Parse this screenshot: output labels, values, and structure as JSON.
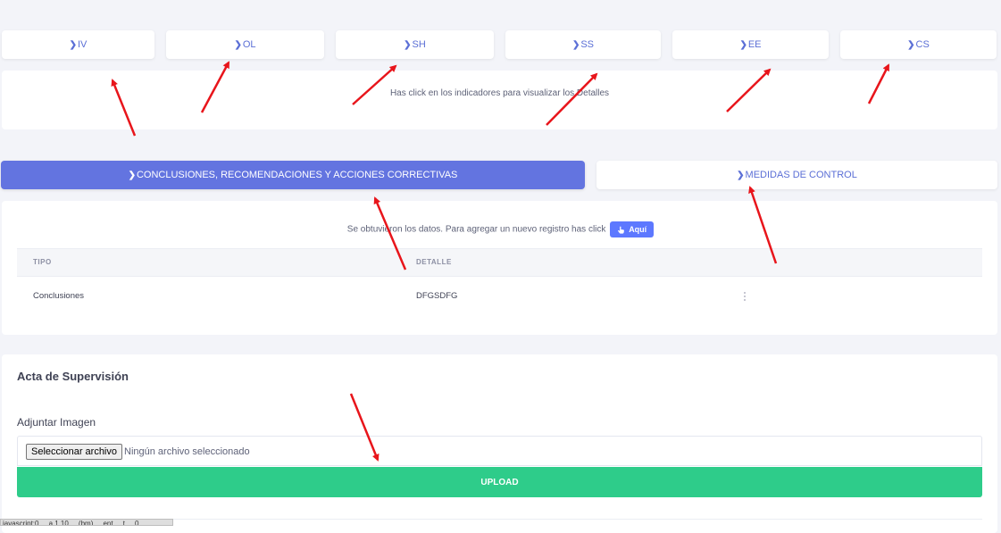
{
  "indicators": [
    {
      "label": "IV"
    },
    {
      "label": "OL"
    },
    {
      "label": "SH"
    },
    {
      "label": "SS"
    },
    {
      "label": "EE"
    },
    {
      "label": "CS"
    }
  ],
  "indicator_hint": "Has click en los indicadores para visualizar los Detalles",
  "tabs": {
    "conclusions": "CONCLUSIONES, RECOMENDACIONES Y ACCIONES CORRECTIVAS",
    "control_measures": "MEDIDAS DE CONTROL"
  },
  "records": {
    "message": "Se obtuvieron los datos. Para agregar un nuevo registro has click",
    "add_button": "Aquí",
    "columns": [
      "TIPO",
      "DETALLE"
    ],
    "rows": [
      {
        "tipo": "Conclusiones",
        "detalle": "DFGSDFG"
      }
    ]
  },
  "acta": {
    "title": "Acta de Supervisión",
    "attach_label": "Adjuntar Imagen",
    "file_button": "Seleccionar archivo",
    "file_status": "Ningún archivo seleccionado",
    "upload_label": "UPLOAD"
  },
  "status_bar": {
    "text": "javascript:0 ... a 1 10 ... (bm)  ... ent ... t ... 0"
  },
  "colors": {
    "accent": "#5b6fd6",
    "primary_tab": "#6374e0",
    "upload": "#2ecc8a",
    "annotation_arrow": "#e8151b"
  },
  "icons": {
    "chevron": "chevron-right-icon",
    "pointer": "hand-pointer-icon",
    "kebab": "vertical-ellipsis-icon"
  }
}
